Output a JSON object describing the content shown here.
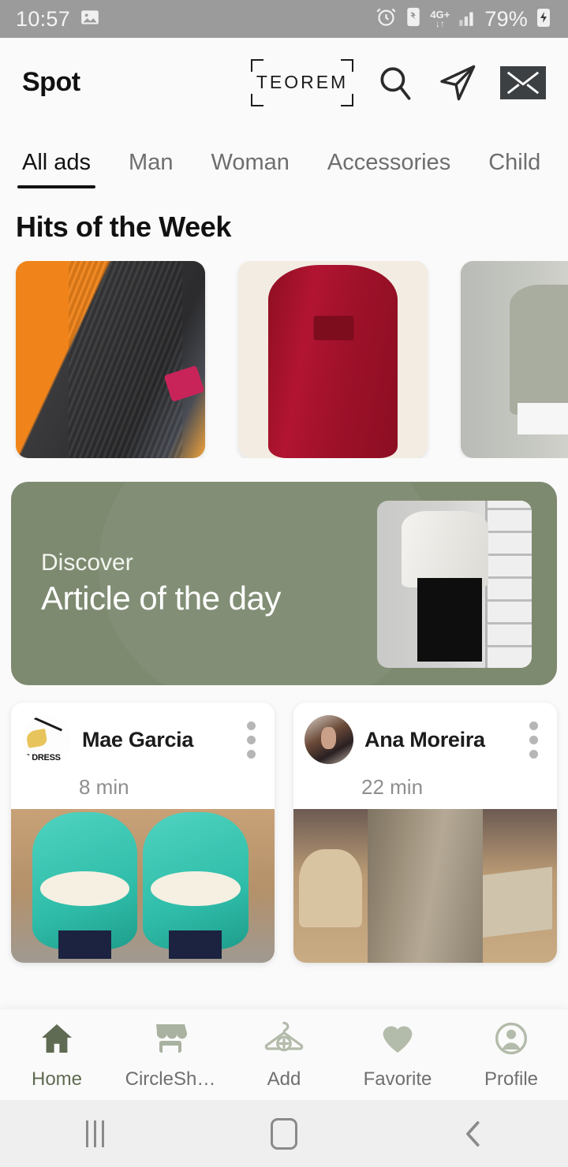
{
  "status_bar": {
    "time": "10:57",
    "gallery_icon": "image-icon",
    "alarm_icon": "alarm-icon",
    "data_saver_icon": "data-saver-icon",
    "network_type": "4G+",
    "network_arrows": "↓↑",
    "signal_icon": "signal-bars-icon",
    "battery_percent": "79%",
    "charging_icon": "battery-charging-icon"
  },
  "app_bar": {
    "brand": "Spot",
    "logo_text": "TEOREM",
    "search_icon": "search-icon",
    "send_icon": "send-icon",
    "mail_icon": "mail-icon"
  },
  "tabs": [
    {
      "label": "All ads",
      "active": true
    },
    {
      "label": "Man",
      "active": false
    },
    {
      "label": "Woman",
      "active": false
    },
    {
      "label": "Accessories",
      "active": false
    },
    {
      "label": "Child",
      "active": false
    }
  ],
  "hits_section": {
    "title": "Hits of the Week",
    "items": [
      {
        "alt": "black-denim-jeans-on-orange-fabric"
      },
      {
        "alt": "red-long-sleeve-dress"
      },
      {
        "alt": "gray-linen-top"
      }
    ]
  },
  "banner": {
    "kicker": "Discover",
    "title": "Article of the day",
    "thumb_alt": "white-blouse-black-skirt-mannequin",
    "bg_color": "#7d8a70"
  },
  "feed": [
    {
      "user": "Mae Garcia",
      "time": "8 min",
      "avatar": "dress-sketch-avatar",
      "avatar_caption": "E DRESS",
      "menu_icon": "kebab-menu-icon",
      "photo_alt": "teal-sneakers-with-white-laces"
    },
    {
      "user": "Ana Moreira",
      "time": "22 min",
      "avatar": "user-photo-avatar",
      "menu_icon": "kebab-menu-icon",
      "photo_alt": "beige-skinny-pants-in-living-room"
    }
  ],
  "bottom_nav": {
    "active_color": "#5f6b52",
    "inactive_color": "#b3bbaa",
    "items": [
      {
        "label": "Home",
        "icon": "home-icon",
        "active": true
      },
      {
        "label": "CircleSh…",
        "icon": "store-icon",
        "active": false
      },
      {
        "label": "Add",
        "icon": "hanger-plus-icon",
        "active": false
      },
      {
        "label": "Favorite",
        "icon": "heart-icon",
        "active": false
      },
      {
        "label": "Profile",
        "icon": "person-icon",
        "active": false
      }
    ]
  },
  "android_nav": {
    "recents_icon": "recents-icon",
    "home_icon": "home-square-icon",
    "back_icon": "back-chevron-icon"
  }
}
